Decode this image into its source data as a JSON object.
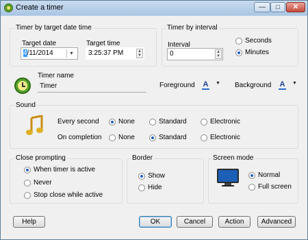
{
  "window": {
    "title": "Create a timer"
  },
  "target_date_group": {
    "heading": "Timer by target date time",
    "date_label": "Target date",
    "date_selected_part": "4",
    "date_value": "/11/2014",
    "time_label": "Target time",
    "time_value": "3:25:37 PM"
  },
  "interval_group": {
    "heading": "Timer by interval",
    "interval_label": "Interval",
    "interval_value": "0",
    "seconds_label": "Seconds",
    "minutes_label": "Minutes",
    "selected_unit": "Minutes"
  },
  "timer_name": {
    "label": "Timer name",
    "value": "Timer",
    "foreground_label": "Foreground",
    "background_label": "Background",
    "font_glyph": "A"
  },
  "sound_group": {
    "heading": "Sound",
    "every_second_label": "Every second",
    "on_completion_label": "On completion",
    "none_label": "None",
    "standard_label": "Standard",
    "electronic_label": "Electronic",
    "every_second_selected": "None",
    "on_completion_selected": "Standard"
  },
  "close_prompting": {
    "heading": "Close prompting",
    "options": [
      "When timer is active",
      "Never",
      "Stop close while active"
    ],
    "selected": "When timer is active"
  },
  "border": {
    "heading": "Border",
    "options": [
      "Show",
      "Hide"
    ],
    "selected": "Show"
  },
  "screen_mode": {
    "heading": "Screen mode",
    "options": [
      "Normal",
      "Full screen"
    ],
    "selected": "Normal"
  },
  "buttons": {
    "help": "Help",
    "ok": "OK",
    "cancel": "Cancel",
    "action": "Action",
    "advanced": "Advanced"
  },
  "colors": {
    "accent": "#3399ff",
    "clock_green": "#58a12f",
    "note_gold": "#e0b022"
  }
}
